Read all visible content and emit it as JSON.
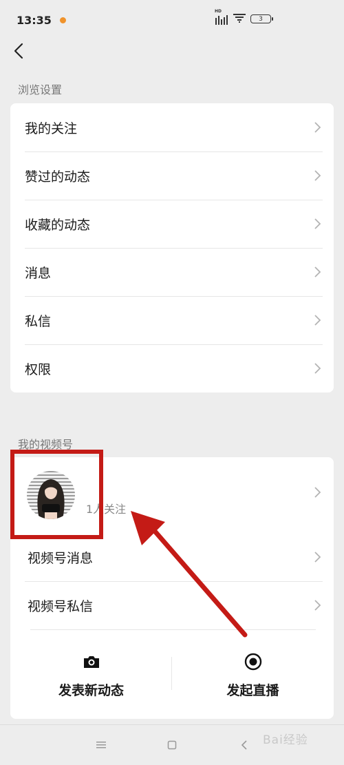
{
  "status_bar": {
    "time": "13:35",
    "network": "HD",
    "battery": "3"
  },
  "back_icon": "chevron-left-icon",
  "browse_settings": {
    "title": "浏览设置",
    "items": [
      {
        "label": "我的关注"
      },
      {
        "label": "赞过的动态"
      },
      {
        "label": "收藏的动态"
      },
      {
        "label": "消息"
      },
      {
        "label": "私信"
      },
      {
        "label": "权限"
      }
    ]
  },
  "channels": {
    "title": "我的视频号",
    "profile": {
      "follow_count": "1人关注"
    },
    "items": [
      {
        "label": "视频号消息"
      },
      {
        "label": "视频号私信"
      }
    ],
    "actions": [
      {
        "label": "发表新动态",
        "icon": "camera-icon"
      },
      {
        "label": "发起直播",
        "icon": "live-record-icon"
      }
    ]
  },
  "watermark": "Bai经验",
  "colors": {
    "background": "#ededed",
    "highlight": "#c41b16",
    "accent": "#f0932b"
  }
}
